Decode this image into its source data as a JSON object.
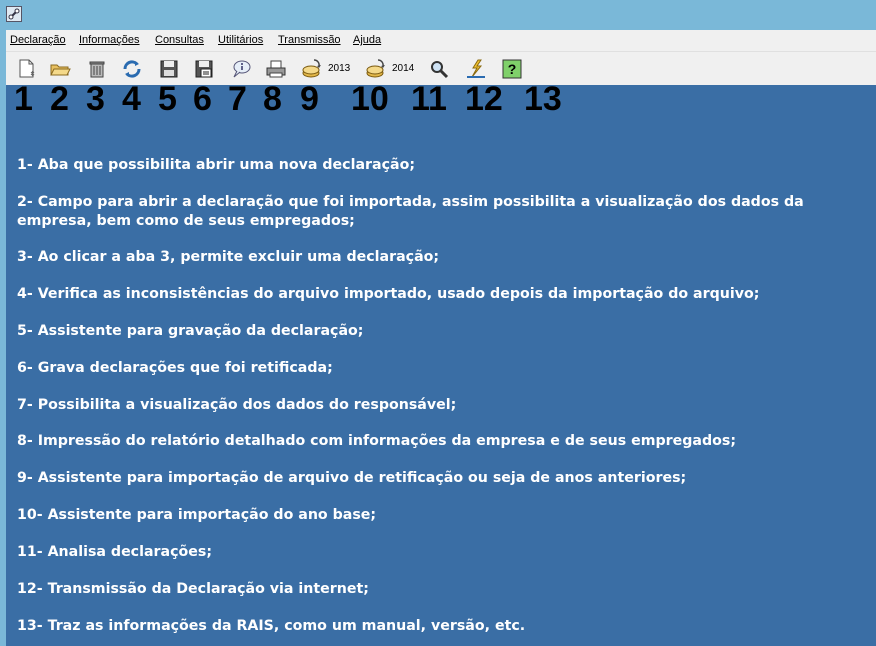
{
  "menu": {
    "items": [
      {
        "label": "Declaração"
      },
      {
        "label": "Informações"
      },
      {
        "label": "Consultas"
      },
      {
        "label": "Utilitários"
      },
      {
        "label": "Transmissão"
      },
      {
        "label": "Ajuda"
      }
    ]
  },
  "toolbar": {
    "year_2013": "2013",
    "year_2014": "2014"
  },
  "callouts": [
    "1",
    "2",
    "3",
    "4",
    "5",
    "6",
    "7",
    "8",
    "9",
    "10",
    "11",
    "12",
    "13"
  ],
  "descriptions": [
    "1- Aba que possibilita abrir uma nova declaração;",
    "2- Campo para abrir a declaração que foi importada, assim possibilita a visualização dos dados da empresa, bem como de seus empregados;",
    "3- Ao clicar a aba 3, permite excluir uma declaração;",
    "4- Verifica as inconsistências do arquivo importado, usado depois da importação do arquivo;",
    "5- Assistente para gravação da declaração;",
    "6- Grava declarações que foi retificada;",
    "7- Possibilita a visualização dos dados do responsável;",
    "8- Impressão do relatório detalhado com informações da empresa e de seus empregados;",
    "9- Assistente para importação de arquivo de retificação ou seja de anos anteriores;",
    "10- Assistente para importação do ano base;",
    "11- Analisa declarações;",
    "12- Transmissão da Declaração via internet;",
    "13- Traz as informações da RAIS, como um manual, versão, etc."
  ]
}
